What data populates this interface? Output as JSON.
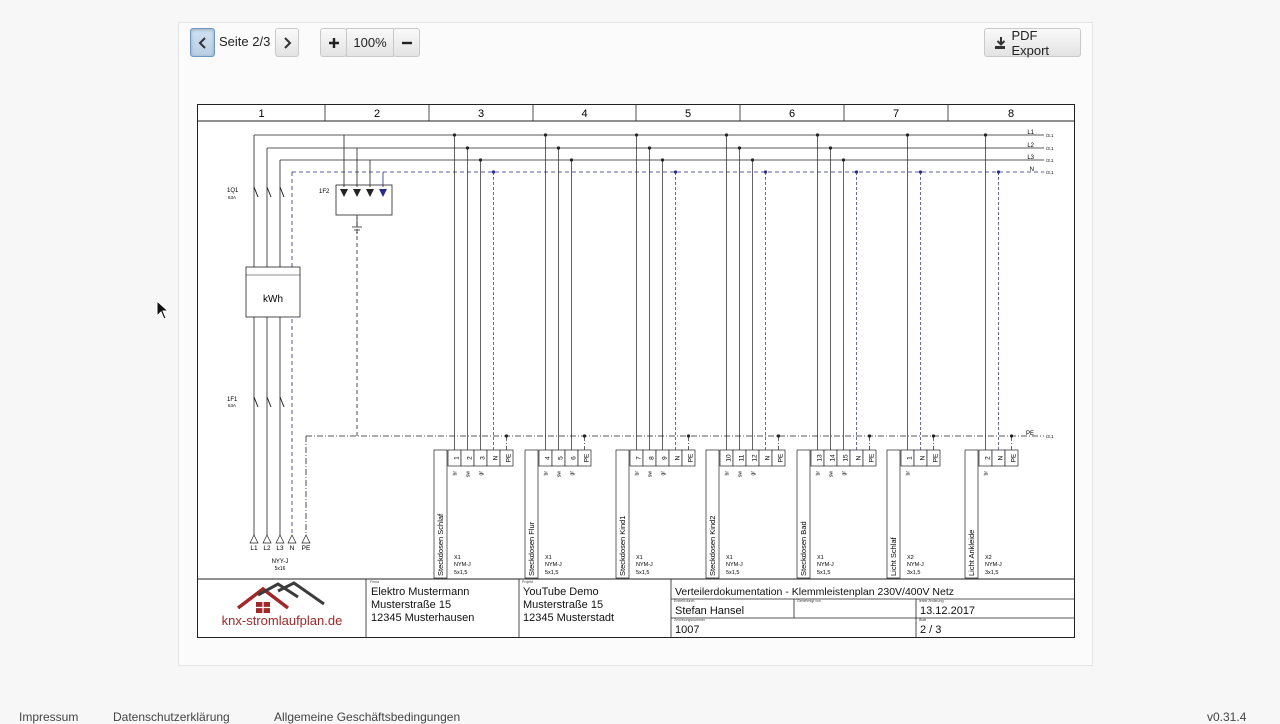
{
  "toolbar": {
    "prev_icon": "chevron-left-icon",
    "next_icon": "chevron-right-icon",
    "page_label": "Seite 2/3",
    "zoom_in_icon": "plus-icon",
    "zoom_out_icon": "minus-icon",
    "zoom_level": "100%",
    "pdf_icon": "download-icon",
    "pdf_label": "PDF Export"
  },
  "grid": {
    "columns": [
      "1",
      "2",
      "3",
      "4",
      "5",
      "6",
      "7",
      "8"
    ]
  },
  "schematic": {
    "bus_labels": [
      "L1",
      "L2",
      "L3",
      "N",
      "PE"
    ],
    "bus_refs": [
      "/3.1",
      "/3.1",
      "/3.1",
      "/3.1",
      "/3.1"
    ],
    "main_switch": {
      "id": "1Q1",
      "rating": "63A"
    },
    "rcd": {
      "id": "1F1",
      "rating": "63A"
    },
    "spd": {
      "id": "1F2"
    },
    "meter_label": "kWh",
    "feed_terminals": [
      "L1",
      "L2",
      "L3",
      "N",
      "PE"
    ],
    "feed_cable": {
      "type": "NYY-J",
      "size": "5x16"
    },
    "terminal_groups": [
      {
        "name": "Steckdosen Schlaf",
        "terminals": [
          "1",
          "2",
          "3",
          "N",
          "PE"
        ],
        "wires": [
          "br",
          "sw",
          "gr"
        ],
        "strip": "X1",
        "cable": "NYM-J",
        "size": "5x1,5"
      },
      {
        "name": "Steckdosen Flur",
        "terminals": [
          "4",
          "5",
          "6",
          "PE"
        ],
        "wires": [
          "br",
          "sw",
          "gr"
        ],
        "strip": "X1",
        "cable": "NYM-J",
        "size": "5x1,5"
      },
      {
        "name": "Steckdosen Kind1",
        "terminals": [
          "7",
          "8",
          "9",
          "N",
          "PE"
        ],
        "wires": [
          "br",
          "sw",
          "gr"
        ],
        "strip": "X1",
        "cable": "NYM-J",
        "size": "5x1,5"
      },
      {
        "name": "Steckdosen Kind2",
        "terminals": [
          "10",
          "11",
          "12",
          "N",
          "PE"
        ],
        "wires": [
          "br",
          "sw",
          "gr"
        ],
        "strip": "X1",
        "cable": "NYM-J",
        "size": "5x1,5"
      },
      {
        "name": "Steckdosen Bad",
        "terminals": [
          "13",
          "14",
          "15",
          "N",
          "PE"
        ],
        "wires": [
          "br",
          "sw",
          "gr"
        ],
        "strip": "X1",
        "cable": "NYM-J",
        "size": "5x1,5"
      },
      {
        "name": "Licht Schlaf",
        "terminals": [
          "1",
          "N",
          "PE"
        ],
        "wires": [
          "br"
        ],
        "strip": "X2",
        "cable": "NYM-J",
        "size": "3x1,5"
      },
      {
        "name": "Licht Ankleide",
        "terminals": [
          "2",
          "N",
          "PE"
        ],
        "wires": [
          "br"
        ],
        "strip": "X2",
        "cable": "NYM-J",
        "size": "3x1,5"
      }
    ]
  },
  "title_block": {
    "brand": "knx-stromlaufplan.de",
    "firma_caption": "Firma",
    "firma": [
      "Elektro Mustermann",
      "Musterstraße 15",
      "12345 Musterhausen"
    ],
    "projekt_caption": "Projekt",
    "projekt": [
      "YouTube Demo",
      "Musterstraße 15",
      "12345 Musterstadt"
    ],
    "doc_title": "Verteilerdokumentation - Klemmleistenplan 230V/400V Netz",
    "erstellt_caption": "Erstellt durch",
    "erstellt": "Stefan Hansel",
    "genehmigt_caption": "Genehmigt von",
    "aenderung_caption": "letzte Änderung",
    "date": "13.12.2017",
    "zeichnung_caption": "Zeichnungsnummer",
    "drawing_number": "1007",
    "blatt_caption": "Blatt",
    "sheet": "2 / 3"
  },
  "footer": {
    "links": [
      "Impressum",
      "Datenschutzerklärung",
      "Allgemeine Geschäftsbedingungen"
    ],
    "version": "v0.31.4"
  },
  "colors": {
    "accent": "#6c98c6",
    "logo_red": "#a0282a",
    "logo_dark": "#3c3c3c",
    "spd_blue": "#2a2a8a"
  }
}
